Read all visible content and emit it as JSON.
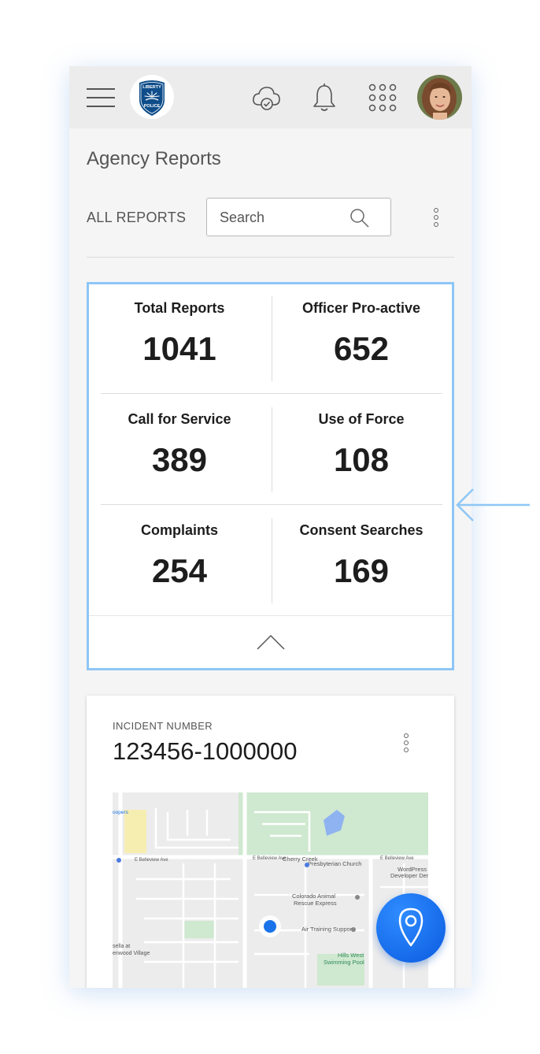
{
  "header": {
    "menu_icon": "hamburger-menu-icon",
    "logo_text_top": "LIBERTY",
    "logo_text_bottom": "POLICE",
    "icons": [
      "cloud-check-icon",
      "bell-icon",
      "apps-grid-icon"
    ],
    "colors": {
      "logo_blue": "#0e4d8a",
      "bar": "#ececec"
    }
  },
  "page": {
    "title": "Agency Reports",
    "filter_label": "ALL REPORTS",
    "search_placeholder": "Search"
  },
  "stats": [
    {
      "label": "Total Reports",
      "value": "1041"
    },
    {
      "label": "Officer Pro-active",
      "value": "652"
    },
    {
      "label": "Call for Service",
      "value": "389"
    },
    {
      "label": "Use of Force",
      "value": "108"
    },
    {
      "label": "Complaints",
      "value": "254"
    },
    {
      "label": "Consent Searches",
      "value": "169"
    }
  ],
  "incident": {
    "label": "INCIDENT NUMBER",
    "number": "123456-1000000"
  },
  "map": {
    "labels": {
      "cherry_creek": "Cherry Creek",
      "presbyterian": "Presbyterian Church",
      "colorado_animal": "Colorado Animal",
      "rescue_express": "Rescue Express",
      "air_training": "Air Training Support",
      "hills_west": "Hills West",
      "swimming_pool": "Swimming Pool",
      "wordpress": "WordPress",
      "developer_denver": "Developer Denver",
      "belleview_w": "E Belleview Ave",
      "belleview_mid": "E Belleview Ave",
      "belleview_e": "E Belleview Ave",
      "roopers": "oopers",
      "village1": "sella at",
      "village2": "enwood Village"
    }
  },
  "fab": {
    "icon": "map-pin-icon"
  },
  "annotation": {
    "icon": "arrow-left-icon",
    "color": "#8ec6f6"
  }
}
